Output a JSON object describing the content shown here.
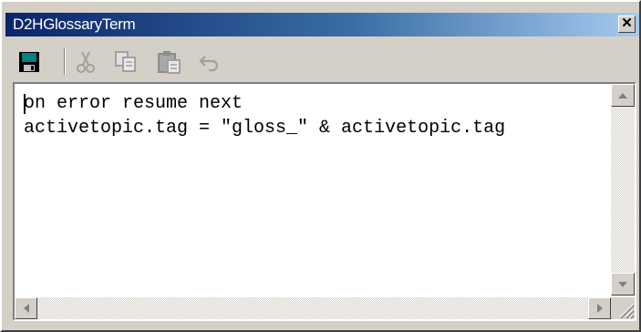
{
  "window": {
    "title": "D2HGlossaryTerm",
    "close_glyph": "✕"
  },
  "toolbar": {
    "buttons": [
      {
        "name": "save",
        "icon": "save-icon",
        "enabled": true
      },
      {
        "name": "cut",
        "icon": "scissors-icon",
        "enabled": false
      },
      {
        "name": "copy",
        "icon": "copy-icon",
        "enabled": false
      },
      {
        "name": "paste",
        "icon": "paste-icon",
        "enabled": false
      },
      {
        "name": "undo",
        "icon": "undo-icon",
        "enabled": false
      }
    ]
  },
  "editor": {
    "lines": [
      "on error resume next",
      "activetopic.tag = \"gloss_\" & activetopic.tag"
    ]
  },
  "colors": {
    "title_gradient_start": "#0a246a",
    "title_gradient_end": "#a6caf0",
    "face": "#d4d0c8",
    "disabled_icon": "#a0a0a0"
  }
}
